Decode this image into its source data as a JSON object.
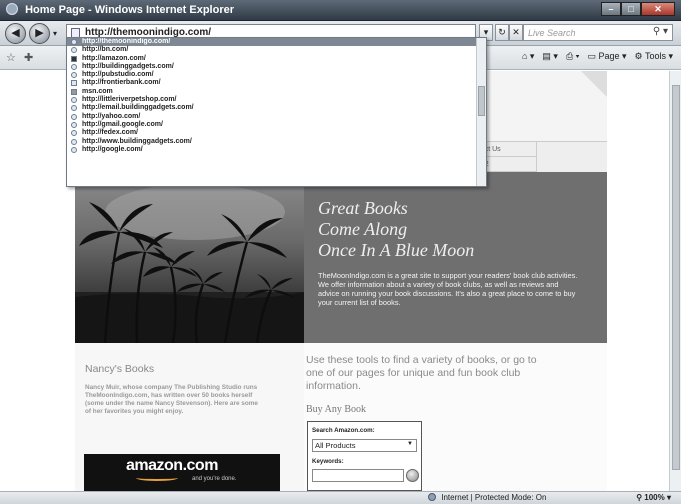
{
  "window": {
    "title": "Home Page - Windows Internet Explorer"
  },
  "address_bar": {
    "url": "http://themoonindigo.com/"
  },
  "search": {
    "placeholder": "Live Search"
  },
  "command_bar": {
    "page_label": "Page",
    "tools_label": "Tools"
  },
  "autocomplete": [
    "http://themoonindigo.com/",
    "http://bn.com/",
    "http://amazon.com/",
    "http://buildinggadgets.com/",
    "http://pubstudio.com/",
    "http://frontierbank.com/",
    "msn.com",
    "http://littleriverpetshop.com/",
    "http://email.buildinggadgets.com/",
    "http://yahoo.com/",
    "http://gmail.google.com/",
    "http://fedex.com/",
    "http://www.buildinggadgets.com/",
    "http://google.com/"
  ],
  "site_nav": {
    "contact": "ntact Us",
    "photo": "oto2"
  },
  "hero": {
    "headline": [
      "Great Books",
      "Come Along",
      "Once In A Blue Moon"
    ],
    "intro": "TheMoonIndigo.com is a great site to support your readers' book club activities. We offer information about a variety of book clubs, as well as reviews and advice on running your book discussions. It's also a great place to come to buy your current list of books."
  },
  "nancy": {
    "heading": "Nancy's Books",
    "body": "Nancy Muir, whose company The Publishing Studio runs TheMoonIndigo.com, has written over 50 books herself (some under the name Nancy Stevenson). Here are some of her favorites you might enjoy."
  },
  "amazon_banner": {
    "wordmark": "amazon.com",
    "tagline": "and you're done."
  },
  "tools": {
    "text": "Use these tools to find a variety of books, or go to one of our pages for unique and fun book club information.",
    "buy_heading": "Buy Any Book"
  },
  "widget": {
    "search_label": "Search Amazon.com:",
    "category": "All Products",
    "keywords_label": "Keywords:"
  },
  "status": {
    "zone": "Internet | Protected Mode: On",
    "zoom": "100%"
  }
}
